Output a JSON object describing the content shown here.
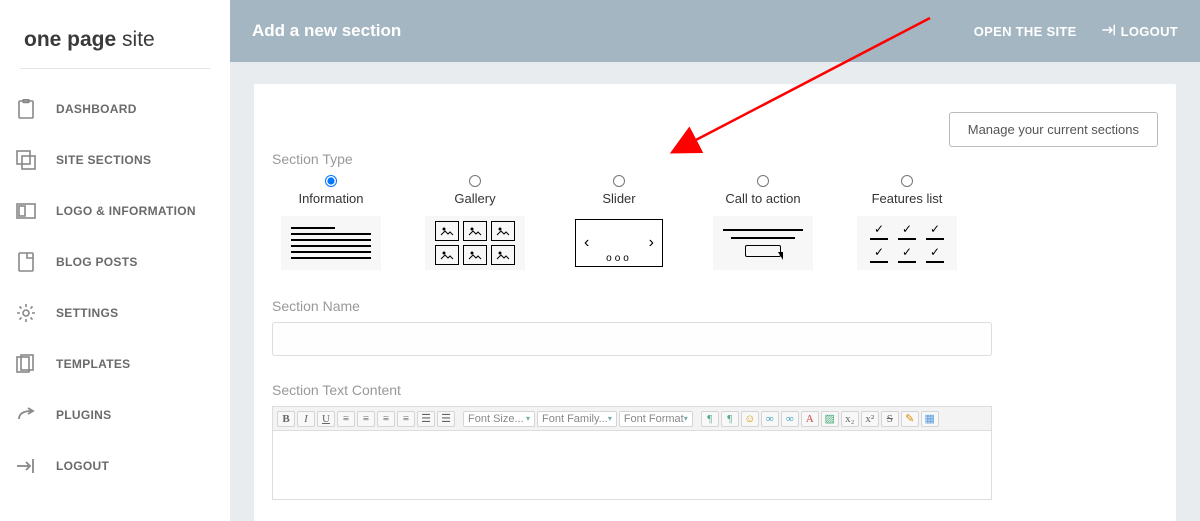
{
  "brand": {
    "bold": "one page",
    "rest": " site"
  },
  "nav": [
    {
      "label": "DASHBOARD",
      "icon": "clipboard-icon"
    },
    {
      "label": "SITE SECTIONS",
      "icon": "copy-icon"
    },
    {
      "label": "LOGO & INFORMATION",
      "icon": "rectangle-icon"
    },
    {
      "label": "BLOG POSTS",
      "icon": "document-icon"
    },
    {
      "label": "SETTINGS",
      "icon": "gear-icon"
    },
    {
      "label": "TEMPLATES",
      "icon": "files-icon"
    },
    {
      "label": "PLUGINS",
      "icon": "share-icon"
    },
    {
      "label": "LOGOUT",
      "icon": "logout-icon"
    }
  ],
  "header": {
    "title": "Add a new section",
    "open_site": "OPEN THE SITE",
    "logout": "LOGOUT"
  },
  "buttons": {
    "manage": "Manage your current sections"
  },
  "labels": {
    "section_type": "Section Type",
    "section_name": "Section Name",
    "section_text": "Section Text Content"
  },
  "section_types": [
    {
      "label": "Information",
      "selected": true
    },
    {
      "label": "Gallery",
      "selected": false
    },
    {
      "label": "Slider",
      "selected": false
    },
    {
      "label": "Call to action",
      "selected": false
    },
    {
      "label": "Features list",
      "selected": false
    }
  ],
  "toolbar": {
    "font_size": "Font Size...",
    "font_family": "Font Family...",
    "font_format": "Font Format"
  },
  "icons": {
    "tick": "✓",
    "arrow_left": "‹",
    "arrow_right": "›",
    "dots": "ooo"
  }
}
